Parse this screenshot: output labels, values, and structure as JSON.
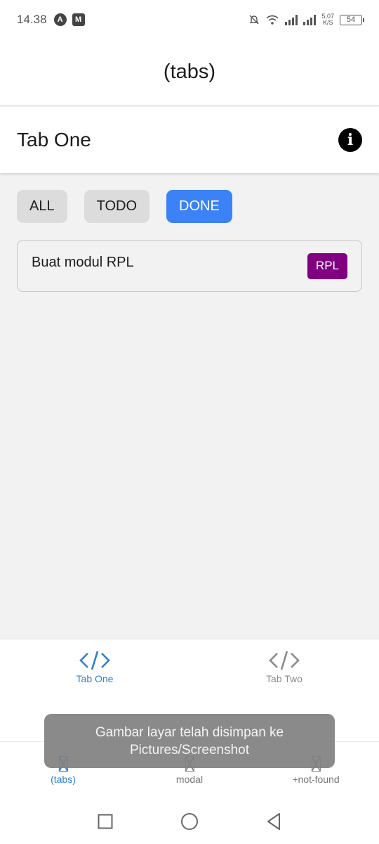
{
  "status_bar": {
    "time": "14.38",
    "net_speed_value": "5,07",
    "net_speed_unit": "K/S",
    "battery": "54"
  },
  "app_header": {
    "title": "(tabs)"
  },
  "screen": {
    "title": "Tab One",
    "info_icon": "info-circle-icon"
  },
  "filters": [
    {
      "label": "ALL",
      "active": false
    },
    {
      "label": "TODO",
      "active": false
    },
    {
      "label": "DONE",
      "active": true
    }
  ],
  "tasks": [
    {
      "title": "Buat modul RPL",
      "tag": "RPL",
      "tag_color": "#800080"
    }
  ],
  "inner_tabs": [
    {
      "label": "Tab One",
      "icon": "code-icon",
      "active": true
    },
    {
      "label": "Tab Two",
      "icon": "code-icon",
      "active": false
    }
  ],
  "outer_tabs": [
    {
      "label": "(tabs)",
      "active": true
    },
    {
      "label": "modal",
      "active": false
    },
    {
      "label": "+not-found",
      "active": false
    }
  ],
  "toast": {
    "text": "Gambar layar telah disimpan ke Pictures/Screenshot"
  },
  "colors": {
    "accent": "#3b82f6",
    "tab_active": "#2f80d1",
    "tag": "#800080"
  }
}
